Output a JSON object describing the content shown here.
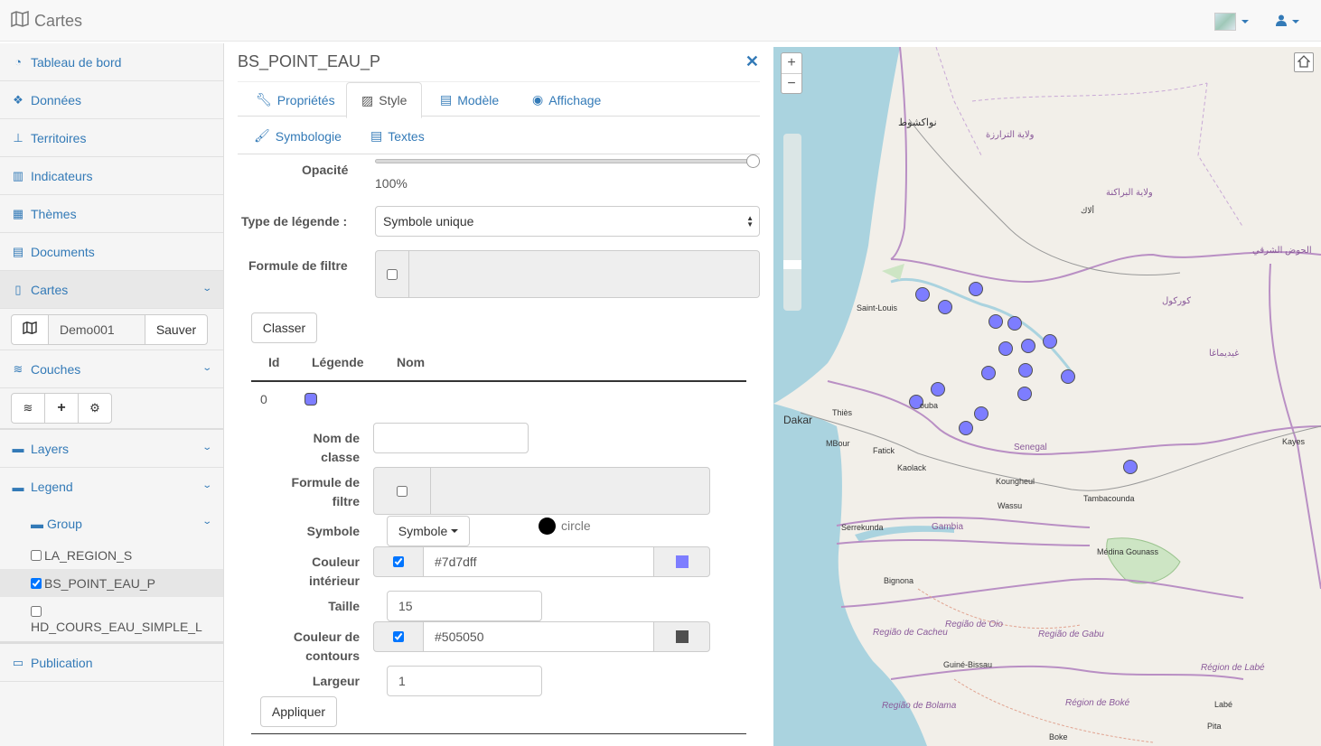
{
  "app": {
    "title": "Cartes"
  },
  "sidebar": {
    "items": [
      {
        "label": "Tableau de bord",
        "icon": "dashboard-icon"
      },
      {
        "label": "Données",
        "icon": "cubes-icon"
      },
      {
        "label": "Territoires",
        "icon": "sitemap-icon"
      },
      {
        "label": "Indicateurs",
        "icon": "bar-chart-icon"
      },
      {
        "label": "Thèmes",
        "icon": "grid-icon"
      },
      {
        "label": "Documents",
        "icon": "document-icon"
      },
      {
        "label": "Cartes",
        "icon": "map-icon"
      }
    ],
    "map_name": "Demo001",
    "save_label": "Sauver",
    "couches_label": "Couches",
    "layers_label": "Layers",
    "legend_label": "Legend",
    "group_label": "Group",
    "legend_layers": [
      {
        "name": "LA_REGION_S",
        "checked": false
      },
      {
        "name": "BS_POINT_EAU_P",
        "checked": true
      },
      {
        "name": "HD_COURS_EAU_SIMPLE_L",
        "checked": false
      }
    ],
    "publication_label": "Publication"
  },
  "panel": {
    "title": "BS_POINT_EAU_P",
    "tabs": [
      "Propriétés",
      "Style",
      "Modèle",
      "Affichage"
    ],
    "active_tab": "Style",
    "subtabs": [
      "Symbologie",
      "Textes"
    ],
    "opacity_label": "Opacité",
    "opacity_value": "100%",
    "opacity_level": 1.0,
    "legend_type_label": "Type de légende :",
    "legend_type_value": "Symbole unique",
    "filter_label": "Formule de filtre",
    "classify_label": "Classer",
    "table_headers": [
      "Id",
      "Légende",
      "Nom"
    ],
    "row_id": "0",
    "class_name_label": "Nom de classe",
    "class_filter_label": "Formule de filtre",
    "symbol_label": "Symbole",
    "symbol_button": "Symbole",
    "symbol_name": "circle",
    "fill_color_label": "Couleur intérieur",
    "fill_color": "#7d7dff",
    "size_label": "Taille",
    "size_value": "15",
    "stroke_color_label": "Couleur de contours",
    "stroke_color": "#505050",
    "width_label": "Largeur",
    "width_value": "1",
    "apply_label": "Appliquer"
  },
  "map": {
    "labels": {
      "nouakchott": "نواكشوط",
      "trarza": "ولاية الترارزة",
      "brakna": "ولاية البراكنة",
      "aleg": "ألاك",
      "hodh": "الحوض الشرقي",
      "gorgol": "كوركول",
      "guidimaka": "غيديماغا",
      "saint_louis": "Saint-Louis",
      "dakar": "Dakar",
      "thies": "Thiès",
      "touba": "ouba",
      "mbour": "MBour",
      "fatick": "Fatick",
      "kaolack": "Kaolack",
      "senegal": "Senegal",
      "koungheul": "Koungheul",
      "tambacounda": "Tambacounda",
      "kayes": "Kayes",
      "wassu": "Wassu",
      "serrekunda": "Serrekunda",
      "gambia": "Gambia",
      "medina": "Médina Gounass",
      "bignona": "Bignona",
      "oio": "Região de Oio",
      "cacheu": "Região de Cacheu",
      "gabu": "Região de Gabu",
      "guine_bissau": "Guiné-Bissau",
      "bolama": "Região de Bolama",
      "labe_region": "Région de Labé",
      "boke_region": "Région de Boké",
      "labe": "Labé",
      "pita": "Pita",
      "boke": "Boke"
    },
    "point_color": "#7d7dff",
    "point_stroke": "#505050"
  }
}
